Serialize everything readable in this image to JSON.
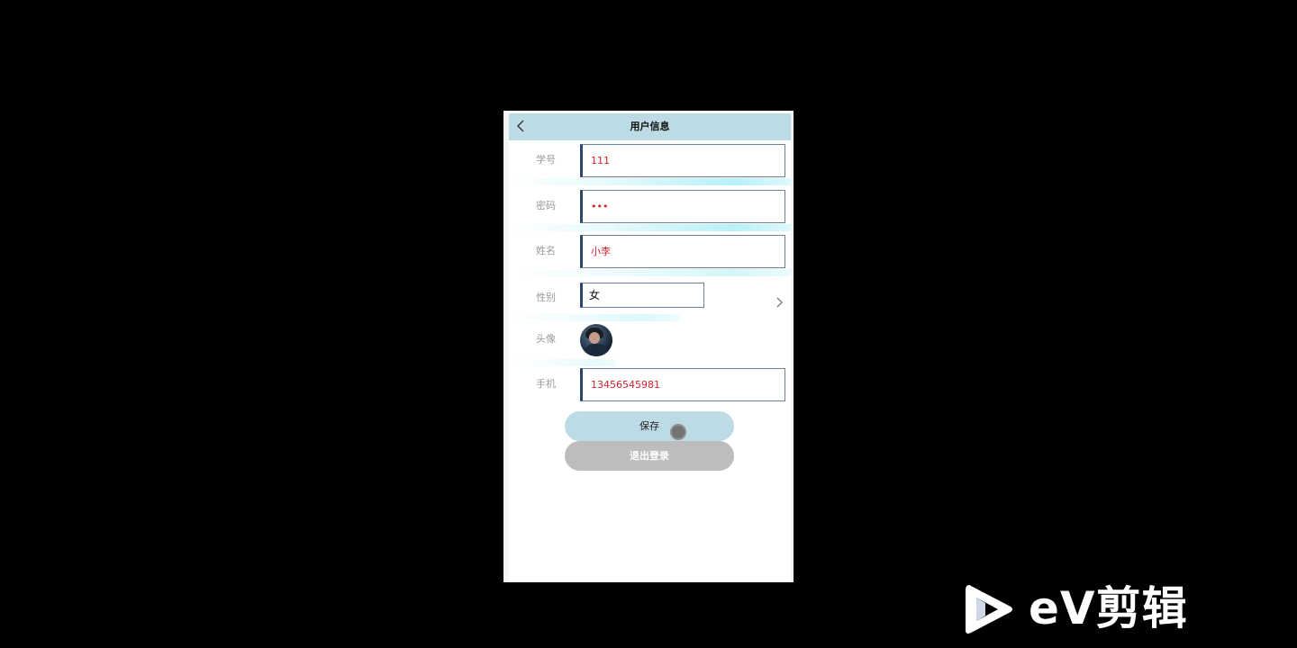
{
  "header": {
    "title": "用户信息",
    "back_icon": "chevron-left-icon"
  },
  "form": {
    "student_id": {
      "label": "学号",
      "value": "111"
    },
    "password": {
      "label": "密码",
      "value": "•••"
    },
    "name": {
      "label": "姓名",
      "value": "小李"
    },
    "gender": {
      "label": "性别",
      "value": "女",
      "arrow_icon": "chevron-right-icon"
    },
    "avatar": {
      "label": "头像"
    },
    "phone": {
      "label": "手机",
      "value": "13456545981"
    }
  },
  "buttons": {
    "save": "保存",
    "logout": "退出登录"
  },
  "watermark": {
    "text": "eV剪辑",
    "icon": "play-icon"
  },
  "colors": {
    "header_bg": "#bddbe4",
    "input_text": "#d3222a",
    "input_accent": "#2d4766",
    "logout_bg": "#bdbdbd"
  }
}
